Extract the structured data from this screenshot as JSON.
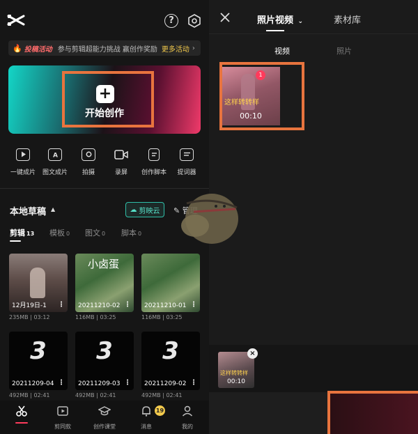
{
  "left": {
    "banner": {
      "tag": "投稿活动",
      "text": "参与剪辑超能力挑战 赢创作奖励",
      "more": "更多活动"
    },
    "hero": {
      "label": "开始创作"
    },
    "tools": [
      {
        "label": "一键成片",
        "icon": "play-square-icon"
      },
      {
        "label": "图文成片",
        "icon": "text-image-icon"
      },
      {
        "label": "拍摄",
        "icon": "camera-icon"
      },
      {
        "label": "录屏",
        "icon": "video-record-icon"
      },
      {
        "label": "创作脚本",
        "icon": "script-icon"
      },
      {
        "label": "提词器",
        "icon": "teleprompter-icon"
      }
    ],
    "drafts": {
      "title": "本地草稿",
      "cloud": "剪映云",
      "manage": "管理"
    },
    "tabs": [
      {
        "label": "剪辑",
        "count": "13"
      },
      {
        "label": "模板",
        "count": "0"
      },
      {
        "label": "图文",
        "count": "0"
      },
      {
        "label": "脚本",
        "count": "0"
      }
    ],
    "cards": [
      {
        "caption": "12月19日-1",
        "size": "235MB",
        "duration": "03:12"
      },
      {
        "caption": "20211210-02",
        "size": "116MB",
        "duration": "03:25",
        "overlay": "小卤蛋"
      },
      {
        "caption": "20211210-01",
        "size": "116MB",
        "duration": "03:25"
      },
      {
        "caption": "20211209-04",
        "size": "492MB",
        "duration": "02:41",
        "big": "3"
      },
      {
        "caption": "20211209-03",
        "size": "492MB",
        "duration": "02:41",
        "big": "3"
      },
      {
        "caption": "20211209-02",
        "size": "492MB",
        "duration": "02:41",
        "big": "3"
      }
    ],
    "nav": [
      {
        "label": "",
        "icon": "scissors-icon"
      },
      {
        "label": "剪同款",
        "icon": "template-icon"
      },
      {
        "label": "创作课堂",
        "icon": "graduation-cap-icon"
      },
      {
        "label": "消息",
        "icon": "bell-icon"
      },
      {
        "label": "我的",
        "icon": "person-icon"
      }
    ],
    "badge": "19"
  },
  "right": {
    "tabs": [
      {
        "label": "照片视频"
      },
      {
        "label": "素材库"
      }
    ],
    "subtabs": [
      {
        "label": "视频"
      },
      {
        "label": "照片"
      }
    ],
    "media": {
      "index": "1",
      "overlay": "这样转转样",
      "duration": "00:10"
    },
    "tray": {
      "overlay": "这样转转样",
      "duration": "00:10"
    }
  },
  "colors": {
    "highlight": "#e8743e",
    "accent": "#ff3b5c",
    "cloud": "#2fbfa8",
    "more": "#f2c94c"
  }
}
